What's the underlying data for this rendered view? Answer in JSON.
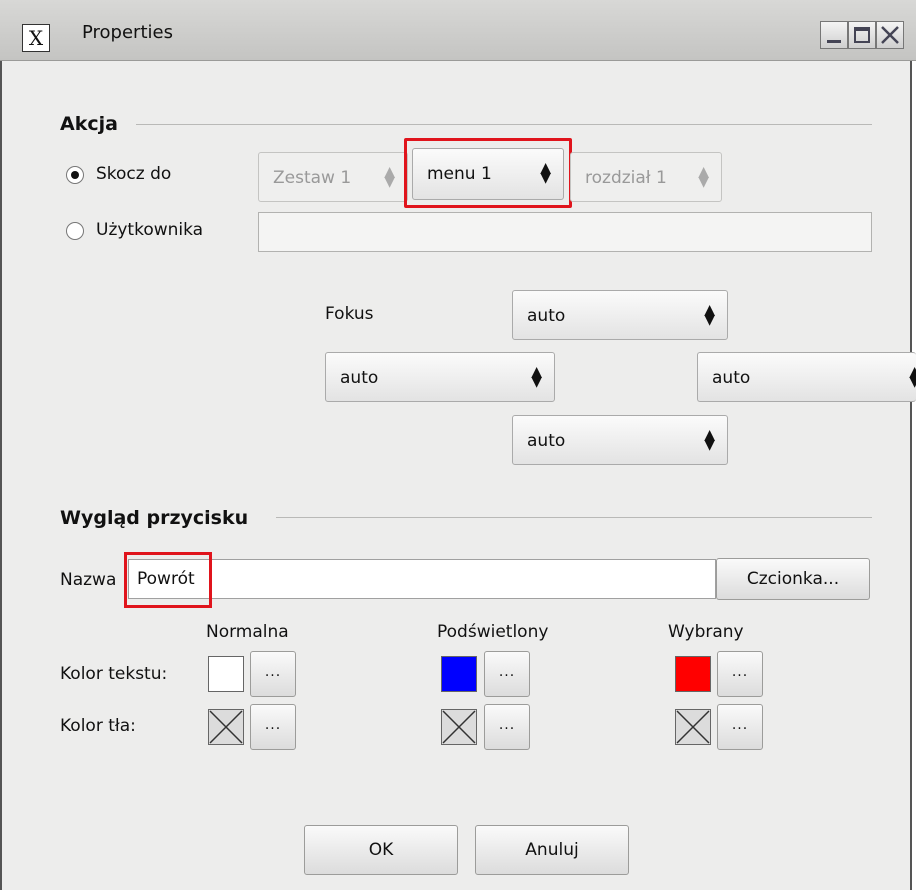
{
  "window": {
    "title": "Properties",
    "app_icon": "X"
  },
  "akcja": {
    "title": "Akcja",
    "jump_label": "Skocz do",
    "user_label": "Użytkownika",
    "jump_selected": true,
    "set_value": "Zestaw 1",
    "menu_value": "menu 1",
    "chapter_value": "rozdział 1",
    "user_value": ""
  },
  "focus": {
    "label": "Fokus",
    "up": "auto",
    "left": "auto",
    "right": "auto",
    "down": "auto"
  },
  "appearance": {
    "title": "Wygląd przycisku",
    "name_label": "Nazwa",
    "name_value": "Powrót",
    "font_button": "Czcionka...",
    "col_normal": "Normalna",
    "col_highlighted": "Podświetlony",
    "col_selected": "Wybrany",
    "text_color_label": "Kolor tekstu:",
    "bg_color_label": "Kolor tła:",
    "pick_label": "...",
    "text_colors": {
      "normal": "#ffffff",
      "highlighted": "#0000ff",
      "selected": "#ff0000"
    }
  },
  "buttons": {
    "ok": "OK",
    "cancel": "Anuluj"
  }
}
